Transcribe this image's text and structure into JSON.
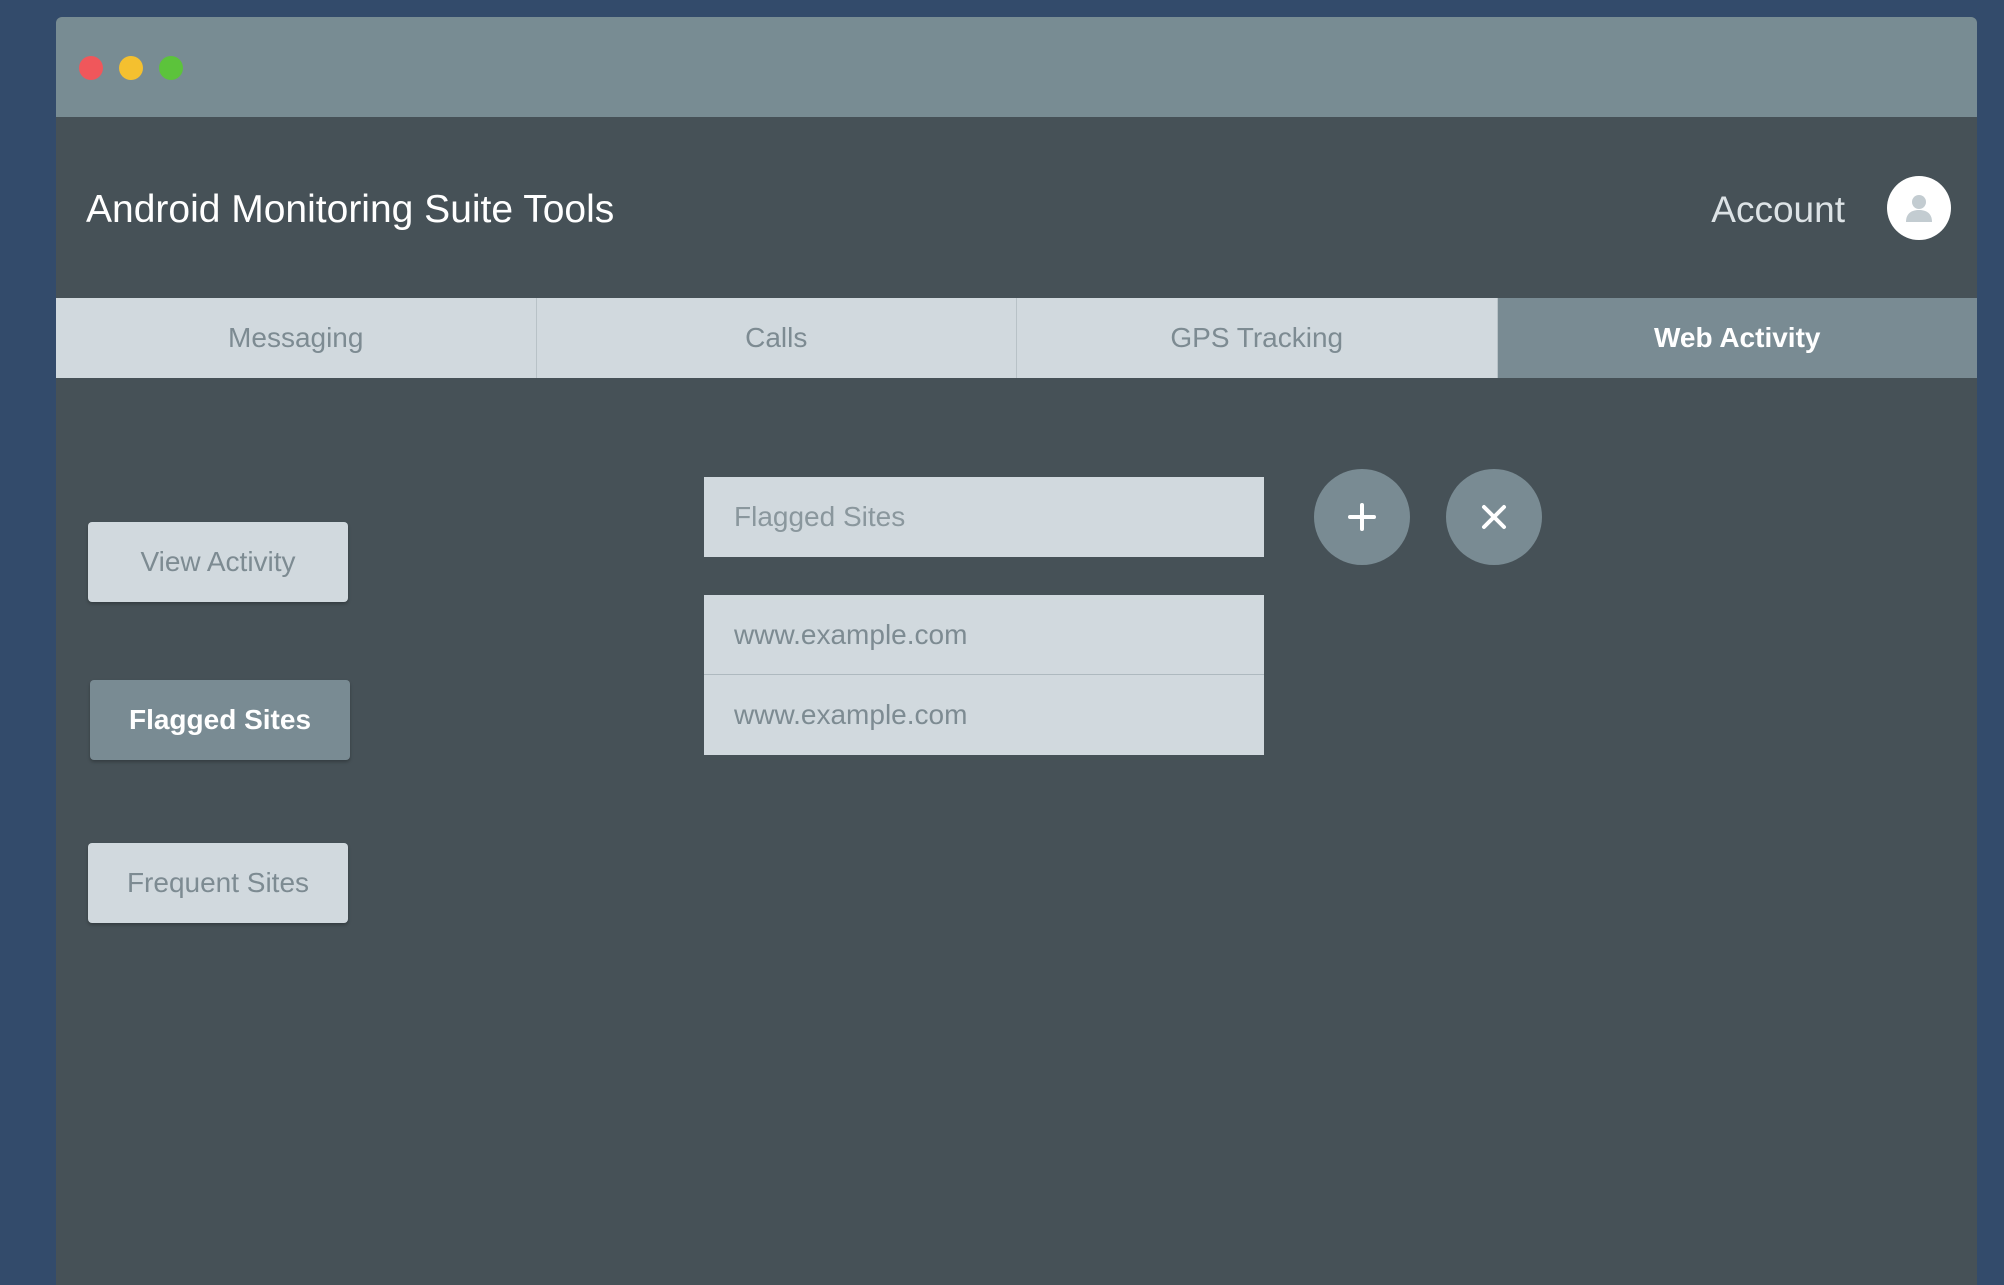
{
  "window": {
    "controls": [
      "close",
      "minimize",
      "maximize"
    ]
  },
  "header": {
    "title": "Android Monitoring Suite Tools",
    "account_label": "Account",
    "avatar_icon": "user-icon"
  },
  "tabs": [
    {
      "label": "Messaging",
      "active": false
    },
    {
      "label": "Calls",
      "active": false
    },
    {
      "label": "GPS Tracking",
      "active": false
    },
    {
      "label": "Web Activity",
      "active": true
    }
  ],
  "sidebar": {
    "items": [
      {
        "label": "View Activity",
        "active": false
      },
      {
        "label": "Flagged Sites",
        "active": true
      },
      {
        "label": "Frequent Sites",
        "active": false
      }
    ]
  },
  "main": {
    "input_placeholder": "Flagged Sites",
    "sites": [
      {
        "url": "www.example.com"
      },
      {
        "url": "www.example.com"
      }
    ],
    "add_icon": "plus-icon",
    "clear_icon": "close-icon"
  },
  "colors": {
    "desktop": "#334b6b",
    "window_bg": "#465157",
    "titlebar": "#788c93",
    "accent": "#798b93",
    "light_surface": "#d1d9de"
  }
}
